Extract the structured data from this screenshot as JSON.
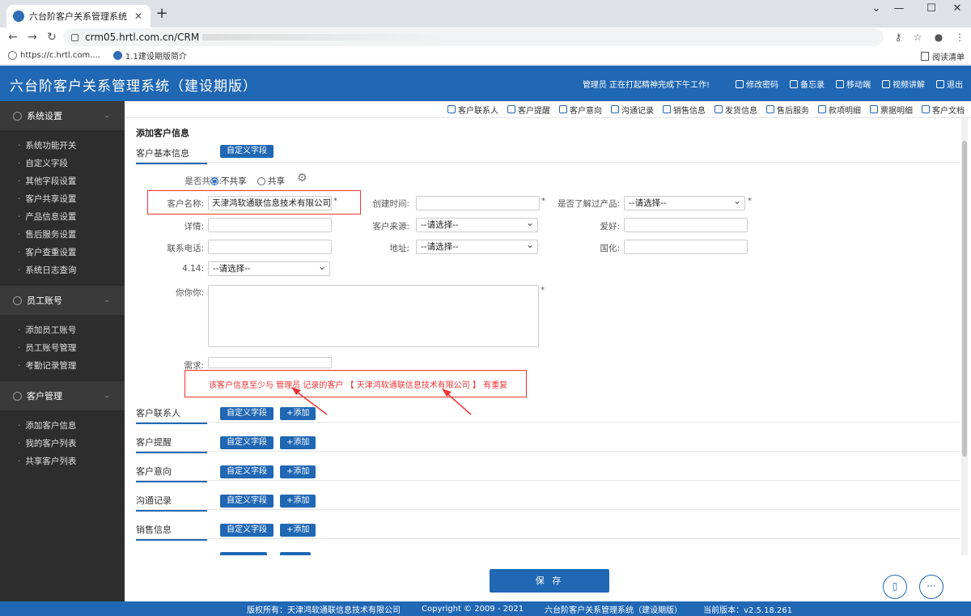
{
  "browser": {
    "tab_title": "六台阶客户关系管理系统（建设期",
    "url": "crm05.hrtl.com.cn/CRM",
    "bookmarks": [
      "https://c.hrtl.com....",
      "1.1建设期版简介"
    ],
    "reader_label": "阅读清单"
  },
  "header": {
    "title": "六台阶客户关系管理系统（建设期版）",
    "greeting": "管理员 正在打起精神完成下午工作!",
    "links": [
      "修改密码",
      "备忘录",
      "移动端",
      "视频讲解",
      "退出"
    ]
  },
  "sidebar": {
    "sections": [
      {
        "title": "系统设置",
        "items": [
          "系统功能开关",
          "自定义字段",
          "其他字段设置",
          "客户共享设置",
          "产品信息设置",
          "售后服务设置",
          "客户查重设置",
          "系统日志查询"
        ]
      },
      {
        "title": "员工账号",
        "items": [
          "添加员工账号",
          "员工账号管理",
          "考勤记录管理"
        ]
      },
      {
        "title": "客户管理",
        "items": [
          "添加客户信息",
          "我的客户列表",
          "共享客户列表"
        ]
      }
    ]
  },
  "toolbar": [
    "客户联系人",
    "客户提醒",
    "客户意向",
    "沟通记录",
    "销售信息",
    "发货信息",
    "售后服务",
    "款项明细",
    "票据明细",
    "客户文档"
  ],
  "form": {
    "page_title": "添加客户信息",
    "basic_section": "客户基本信息",
    "custom_field_btn": "自定义字段",
    "add_btn": "+添加",
    "share_label": "是否共享:",
    "share_options": [
      "不共享",
      "共享"
    ],
    "name_label": "客户名称:",
    "name_value": "天津鸿软通联信息技术有限公司",
    "created_label": "创建时间:",
    "product_label": "是否了解过产品:",
    "select_placeholder": "--请选择--",
    "detail_label": "详情:",
    "source_label": "客户来源:",
    "hobby_label": "爱好:",
    "phone_label": "联系电话:",
    "address_label": "地址:",
    "guohua_label": "国化:",
    "f414_label": "4.14:",
    "nini_label": "你你你:",
    "need_label": "需求:",
    "star": "*",
    "warning": "该客户信息至少与 管理员 记录的客户 【 天津鸿软通联信息技术有限公司 】 有重复",
    "subsections": [
      "客户联系人",
      "客户提醒",
      "客户意向",
      "沟通记录",
      "销售信息"
    ],
    "save_label": "保 存"
  },
  "footer": {
    "owner": "版权所有：天津鸿软通联信息技术有限公司",
    "copyright": "Copyright © 2009 - 2021",
    "system": "六台阶客户关系管理系统（建设期版）",
    "version": "当前版本：v2.5.18.261"
  },
  "colors": {
    "brand": "#2067b4",
    "warning": "#ee3333",
    "sidebar": "#2d2d2d"
  }
}
